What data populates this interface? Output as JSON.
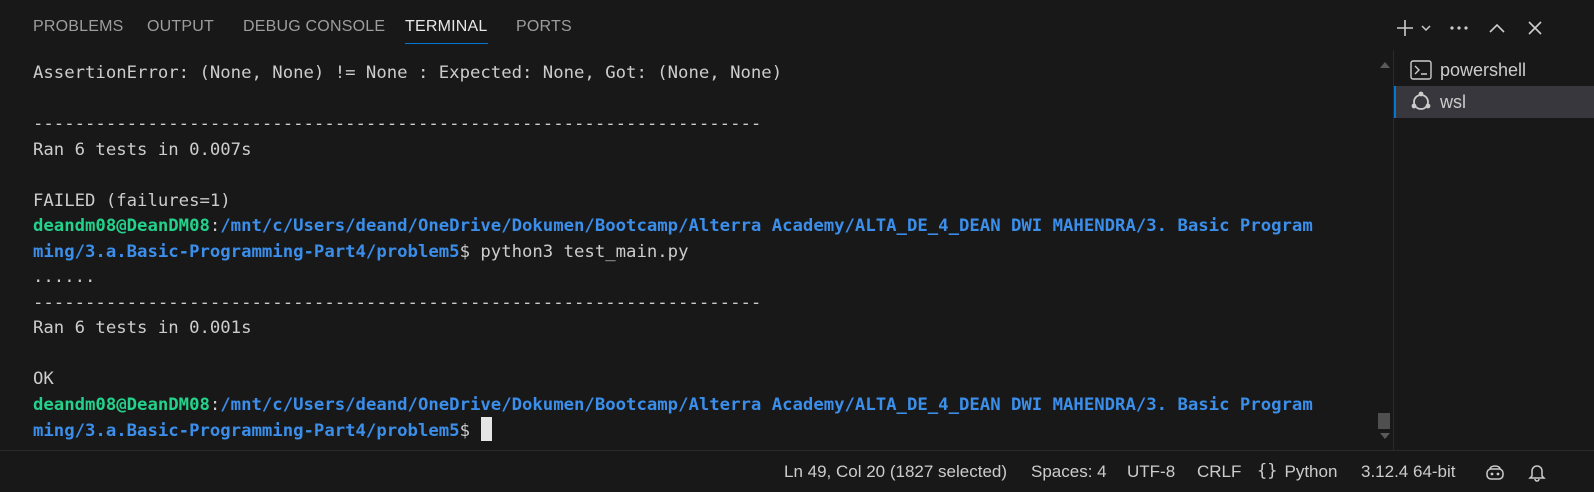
{
  "panel": {
    "tabs": [
      {
        "label": "PROBLEMS"
      },
      {
        "label": "OUTPUT"
      },
      {
        "label": "DEBUG CONSOLE"
      },
      {
        "label": "TERMINAL"
      },
      {
        "label": "PORTS"
      }
    ],
    "active_tab": "TERMINAL",
    "actions": [
      "plus-icon",
      "chevron-down-icon",
      "more-icon",
      "chevron-up-icon",
      "close-icon"
    ]
  },
  "terminal": {
    "lines": [
      {
        "text": "AssertionError: (None, None) != None : Expected: None, Got: (None, None)"
      },
      {
        "text": ""
      },
      {
        "text": "----------------------------------------------------------------------"
      },
      {
        "text": "Ran 6 tests in 0.007s"
      },
      {
        "text": ""
      },
      {
        "text": "FAILED (failures=1)"
      },
      {
        "user": "deandm08@DeanDM08",
        "sep": ":",
        "path": "/mnt/c/Users/deand/OneDrive/Dokumen/Bootcamp/Alterra Academy/ALTA_DE_4_DEAN DWI MAHENDRA/3. Basic Program"
      },
      {
        "path": "ming/3.a.Basic-Programming-Part4/problem5",
        "text": "$ python3 test_main.py"
      },
      {
        "text": "......"
      },
      {
        "text": "----------------------------------------------------------------------"
      },
      {
        "text": "Ran 6 tests in 0.001s"
      },
      {
        "text": ""
      },
      {
        "text": "OK"
      },
      {
        "user": "deandm08@DeanDM08",
        "sep": ":",
        "path": "/mnt/c/Users/deand/OneDrive/Dokumen/Bootcamp/Alterra Academy/ALTA_DE_4_DEAN DWI MAHENDRA/3. Basic Program"
      },
      {
        "path": "ming/3.a.Basic-Programming-Part4/problem5",
        "text": "$ ",
        "cursor": true
      }
    ]
  },
  "terminal_list": [
    {
      "label": "powershell",
      "icon": "terminal-icon",
      "selected": false
    },
    {
      "label": "wsl",
      "icon": "ubuntu-icon",
      "selected": true
    }
  ],
  "status_bar": {
    "position": "Ln 49, Col 20 (1827 selected)",
    "spaces": "Spaces: 4",
    "encoding": "UTF-8",
    "eol": "CRLF",
    "language": "Python",
    "interpreter": "3.12.4 64-bit"
  },
  "colors": {
    "background": "#181818",
    "accent": "#0078d4",
    "prompt_user": "#23d18b",
    "prompt_path": "#3b8eea"
  }
}
